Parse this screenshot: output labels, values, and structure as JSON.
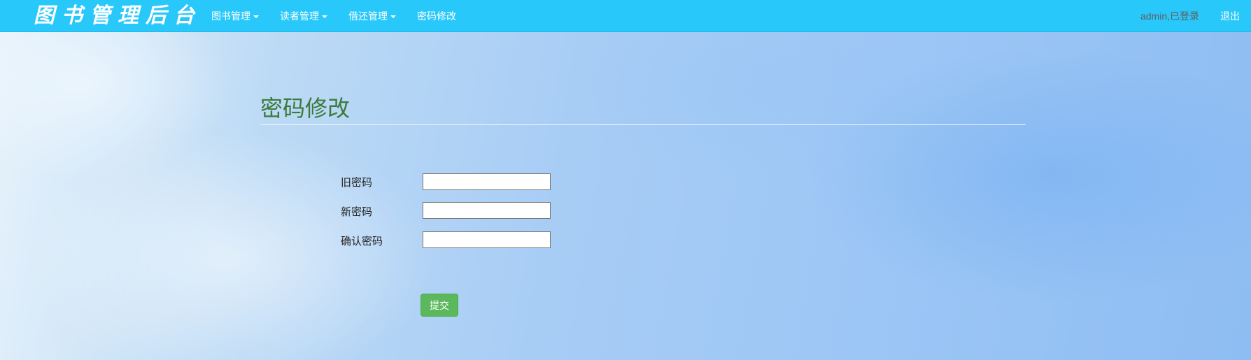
{
  "navbar": {
    "brand": "图书管理后台",
    "items": [
      {
        "label": "图书管理",
        "dropdown": true
      },
      {
        "label": "读者管理",
        "dropdown": true
      },
      {
        "label": "借还管理",
        "dropdown": true
      },
      {
        "label": "密码修改",
        "dropdown": false
      }
    ],
    "status_text": "admin,已登录",
    "logout_label": "退出"
  },
  "page": {
    "title": "密码修改"
  },
  "form": {
    "fields": [
      {
        "label": "旧密码",
        "value": ""
      },
      {
        "label": "新密码",
        "value": ""
      },
      {
        "label": "确认密码",
        "value": ""
      }
    ],
    "submit_label": "提交"
  },
  "colors": {
    "navbar_bg": "#29c8fb",
    "title_color": "#3c7a3c",
    "submit_bg": "#5cb85c"
  }
}
